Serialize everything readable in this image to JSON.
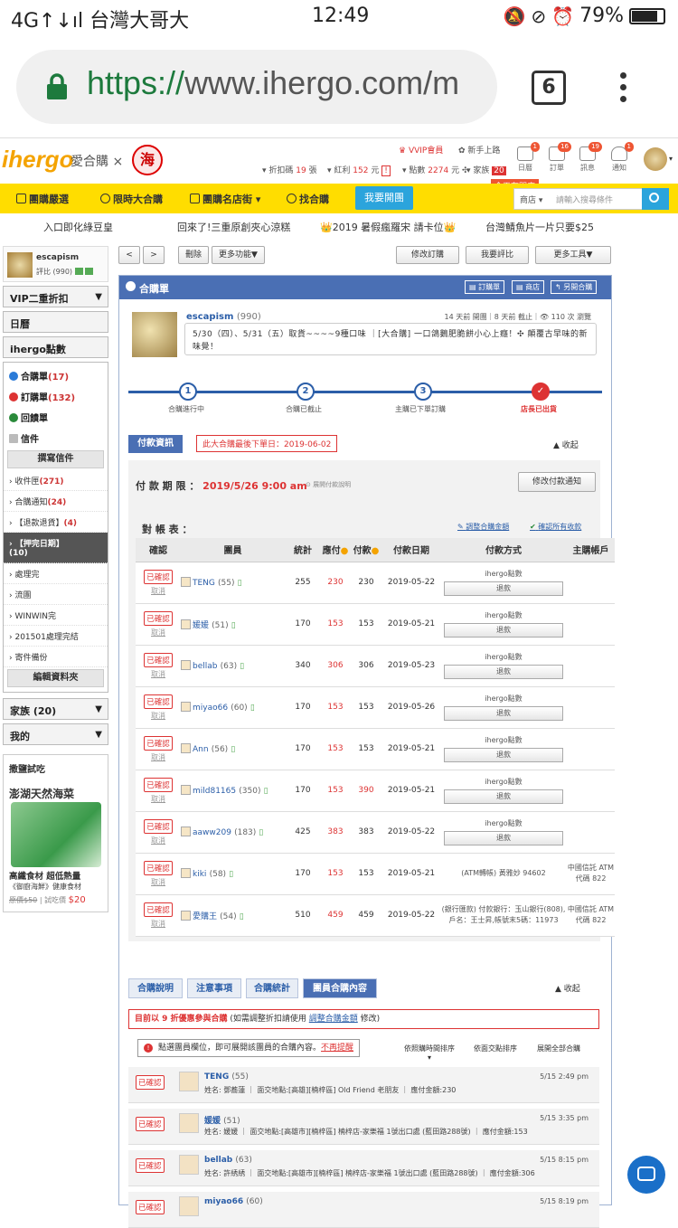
{
  "status_bar": {
    "carrier": "4G↑↓ıl 台灣大哥大",
    "time": "12:49",
    "battery": "79%"
  },
  "browser": {
    "scheme": "https://",
    "url_rest": "www.ihergo.com/m",
    "tab_count": "6"
  },
  "site": {
    "logo_main": "ihergo",
    "logo_sub": "愛合購 ×",
    "seal": "海",
    "vvip": "VVIP會員",
    "newbie": "新手上路",
    "discount_label": "折扣碼",
    "discount_val": "19",
    "discount_unit": "張",
    "bonus_label": "紅利",
    "bonus_val": "152",
    "bonus_unit": "元",
    "points_label": "點數",
    "points_val": "2274",
    "points_unit": "元",
    "family_label": "家族",
    "family_badge": "20",
    "icons": [
      {
        "label": "日曆",
        "badge": "1"
      },
      {
        "label": "訂單",
        "badge": "16"
      },
      {
        "label": "訊息",
        "badge": "19"
      },
      {
        "label": "通知",
        "badge": "1"
      }
    ],
    "today_sticker": "今天有開店"
  },
  "nav": {
    "items": [
      "團購嚴選",
      "限時大合購",
      "團購名店街",
      "找合購"
    ],
    "join_button": "我要開團",
    "search_select": "商店",
    "search_placeholder": "請輸入搜尋條件"
  },
  "ticker": [
    "入口即化綠豆皇",
    "回來了!三重原創夾心涼糕",
    "👑2019 暑假瘋羅宋 請卡位👑",
    "台灣鯖魚片一片只要$25"
  ],
  "sidebar": {
    "user": "escapism",
    "score": "評比 (990)",
    "vip": "VIP二重折扣",
    "calendar": "日曆",
    "points": "ihergo點數",
    "menu": [
      {
        "label": "合購單",
        "count": "(17)"
      },
      {
        "label": "訂購單",
        "count": "(132)"
      },
      {
        "label": "回饋單",
        "count": ""
      },
      {
        "label": "信件",
        "count": ""
      }
    ],
    "write_mail": "撰寫信件",
    "folders": [
      {
        "label": "收件匣",
        "count": "(271)"
      },
      {
        "label": "合購通知",
        "count": "(24)"
      },
      {
        "label": "【退款退貨】",
        "count": "(4)"
      },
      {
        "label": "【押完日期】",
        "count": "(10)"
      },
      {
        "label": "處理完",
        "count": ""
      },
      {
        "label": "流團",
        "count": ""
      },
      {
        "label": "WINWIN完",
        "count": ""
      },
      {
        "label": "201501處理完結",
        "count": ""
      },
      {
        "label": "寄件備份",
        "count": ""
      }
    ],
    "edit_folders": "編輯資料夾",
    "family": "家族 (20)",
    "mine": "我的",
    "trial": {
      "title": "撒鹽試吃",
      "product": "澎湖天然海菜",
      "line1": "高纖食材 超低熱量",
      "line2": "《御廚海鮮》健康食材",
      "orig": "原價$50",
      "sep": " | 試吃價",
      "price": "$20"
    }
  },
  "toolbar": {
    "prev": "<",
    "next": ">",
    "delete": "刪除",
    "more_func": "更多功能▼",
    "edit_order": "修改訂購",
    "my_review": "我要評比",
    "more_tools": "更多工具▼"
  },
  "panel": {
    "title": "合購單",
    "btn_print": "訂購單",
    "btn_shop": "商店",
    "btn_open": "另開合購",
    "owner": "escapism",
    "owner_score": "(990)",
    "meta": "14 天前 開團｜8 天前 截止｜👁 110 次 瀏覽",
    "message": "5/30（四）、5/31（五）取貨~~~~9種口味 ｜[大合購] 一口鴿鵝肥脆餅小心上癮！✣ 顛覆古早味的新味覺！",
    "steps": [
      {
        "num": "1",
        "label": "合購進行中"
      },
      {
        "num": "2",
        "label": "合購已截止"
      },
      {
        "num": "3",
        "label": "主購已下單訂購"
      },
      {
        "num": "✓",
        "label": "店長已出貨"
      }
    ],
    "pay_tab": "付款資訊",
    "last_order": "此大合購最後下單日：2019-06-02",
    "collapse": "▲ 收起",
    "deadline_label": "付 款 期 限 ：",
    "deadline_value": "2019/5/26  9:00 am",
    "deadline_hint": "⊙ 展開付款說明",
    "edit_pay": "修改付款通知",
    "recon_label": "對 帳 表 ：",
    "adjust_amount": "調整合購金額",
    "confirm_all": "確認所有收款",
    "columns": [
      "確認",
      "團員",
      "統計",
      "應付",
      "付款",
      "付款日期",
      "付款方式",
      "主購帳戶"
    ],
    "rows": [
      {
        "member": "TENG",
        "score": "(55)",
        "total": "255",
        "due": "230",
        "paid": "230",
        "paid_red": false,
        "date": "2019-05-22",
        "method": "ihergo點數",
        "refund": "退款",
        "account": ""
      },
      {
        "member": "媛媛",
        "score": "(51)",
        "total": "170",
        "due": "153",
        "paid": "153",
        "paid_red": false,
        "date": "2019-05-21",
        "method": "ihergo點數",
        "refund": "退款",
        "account": ""
      },
      {
        "member": "bellab",
        "score": "(63)",
        "total": "340",
        "due": "306",
        "paid": "306",
        "paid_red": false,
        "date": "2019-05-23",
        "method": "ihergo點數",
        "refund": "退款",
        "account": ""
      },
      {
        "member": "miyao66",
        "score": "(60)",
        "total": "170",
        "due": "153",
        "paid": "153",
        "paid_red": false,
        "date": "2019-05-26",
        "method": "ihergo點數",
        "refund": "退款",
        "account": ""
      },
      {
        "member": "Ann",
        "score": "(56)",
        "total": "170",
        "due": "153",
        "paid": "153",
        "paid_red": false,
        "date": "2019-05-21",
        "method": "ihergo點數",
        "refund": "退款",
        "account": ""
      },
      {
        "member": "mild81165",
        "score": "(350)",
        "total": "170",
        "due": "153",
        "paid": "390",
        "paid_red": true,
        "date": "2019-05-21",
        "method": "ihergo點數",
        "refund": "退款",
        "account": ""
      },
      {
        "member": "aaww209",
        "score": "(183)",
        "total": "425",
        "due": "383",
        "paid": "383",
        "paid_red": false,
        "date": "2019-05-22",
        "method": "ihergo點數",
        "refund": "退款",
        "account": ""
      },
      {
        "member": "kiki",
        "score": "(58)",
        "total": "170",
        "due": "153",
        "paid": "153",
        "paid_red": false,
        "date": "2019-05-21",
        "method": "(ATM轉帳) 黃雅妙 94602",
        "refund": "",
        "account": "中國信託 ATM代碼 822"
      },
      {
        "member": "愛購王",
        "score": "(54)",
        "total": "510",
        "due": "459",
        "paid": "459",
        "paid_red": false,
        "date": "2019-05-22",
        "method": "(銀行匯款) 付款銀行：玉山銀行(808),戶名：王士昇,帳號末5碼：11973",
        "refund": "",
        "account": "中國信託 ATM代碼 822"
      }
    ],
    "confirmed": "已確認",
    "cancel": "取消"
  },
  "bottom": {
    "tabs": [
      "合購說明",
      "注意事項",
      "合購統計",
      "團員合購內容"
    ],
    "collapse": "▲ 收起",
    "notice_red": "目前以 9 折優惠參與合購",
    "notice_mid": " (如需調整折扣請使用 ",
    "notice_link": "調整合購金額",
    "notice_end": " 修改)",
    "hint_icon": "!",
    "hint": "點選團員欄位，即可展開該團員的合購內容。",
    "hint_link": "不再提醒",
    "sort_time": "依照購時間排序",
    "sort_place": "依面交點排序",
    "expand_all": "展開全部合購",
    "list": [
      {
        "name": "TENG",
        "score": "(55)",
        "detail": "姓名: 鄧蕎蓮 ｜ 面交地點:[高雄][楠梓區] Old Friend 老朋友 ｜ 應付金額:230",
        "time": "5/15  2:49 pm"
      },
      {
        "name": "媛媛",
        "score": "(51)",
        "detail": "姓名: 媛媛 ｜ 面交地點:[高雄市][楠梓區] 楠梓店-家樂福 1號出口處 (藍田路288號) ｜ 應付金額:153",
        "time": "5/15  3:35 pm"
      },
      {
        "name": "bellab",
        "score": "(63)",
        "detail": "姓名: 許綉綉 ｜ 面交地點:[高雄市][楠梓區] 楠梓店-家樂福 1號出口處 (藍田路288號) ｜ 應付金額:306",
        "time": "5/15  8:15 pm"
      },
      {
        "name": "miyao66",
        "score": "(60)",
        "detail": "",
        "time": "5/15  8:19 pm"
      }
    ]
  }
}
